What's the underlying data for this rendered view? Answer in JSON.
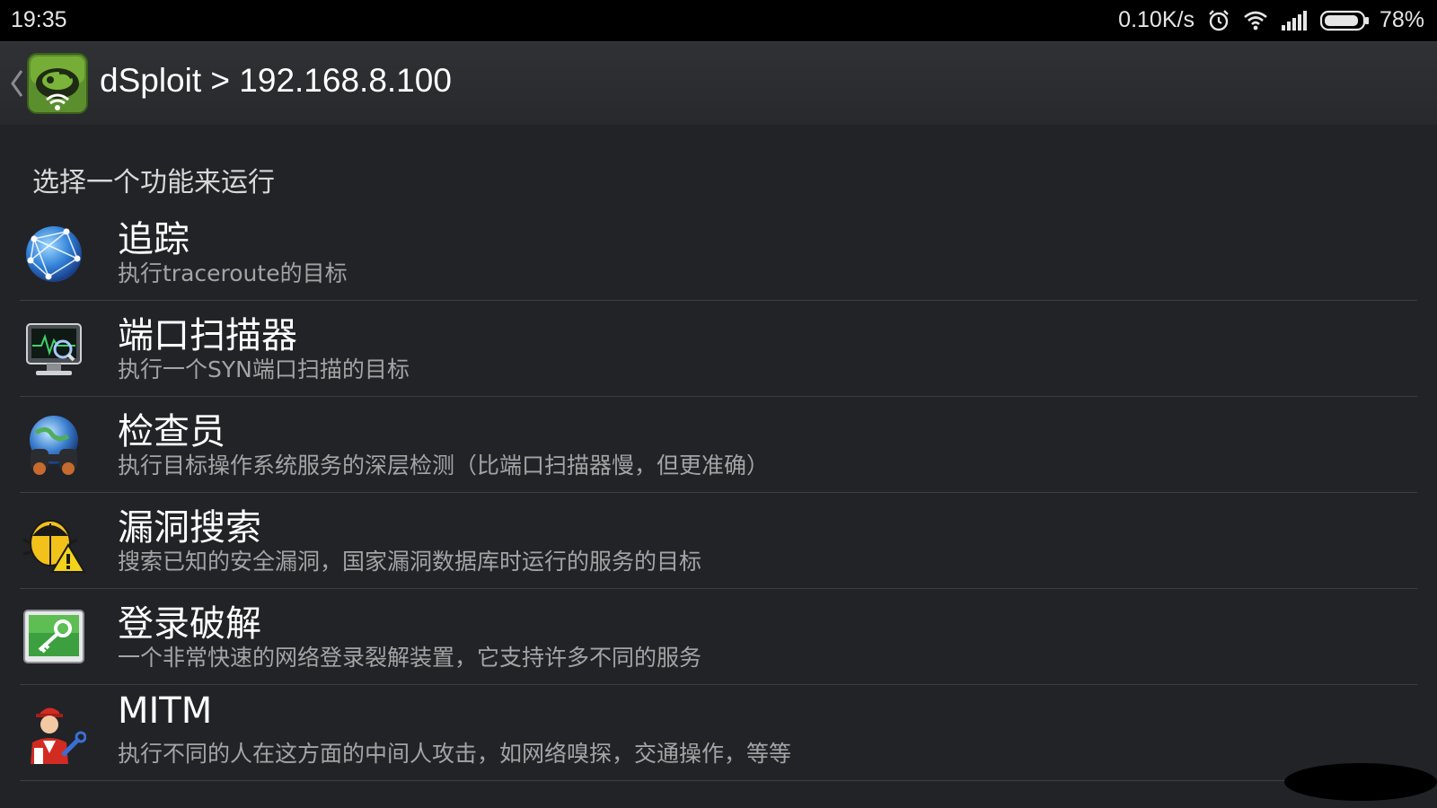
{
  "status_bar": {
    "time": "19:35",
    "net_speed": "0.10K/s",
    "battery": "78%",
    "icons": [
      "alarm-icon",
      "wifi-icon",
      "signal-icon",
      "battery-icon"
    ]
  },
  "action_bar": {
    "title": "dSploit > 192.168.8.100",
    "icons": [
      "back-chevron-icon",
      "dsploit-logo-icon"
    ]
  },
  "section_header": "选择一个功能来运行",
  "items": [
    {
      "title": "追踪",
      "desc": "执行traceroute的目标",
      "icon": "globe-network-icon"
    },
    {
      "title": "端口扫描器",
      "desc": "执行一个SYN端口扫描的目标",
      "icon": "monitor-scan-icon"
    },
    {
      "title": "检查员",
      "desc": "执行目标操作系统服务的深层检测（比端口扫描器慢，但更准确）",
      "icon": "globe-binoculars-icon"
    },
    {
      "title": "漏洞搜索",
      "desc": "搜索已知的安全漏洞，国家漏洞数据库时运行的服务的目标",
      "icon": "bug-warning-icon"
    },
    {
      "title": "登录破解",
      "desc": "一个非常快速的网络登录裂解装置，它支持许多不同的服务",
      "icon": "key-screen-icon"
    },
    {
      "title": "MITM",
      "desc": "执行不同的人在这方面的中间人攻击，如网络嗅探，交通操作，等等",
      "icon": "man-wrench-icon"
    }
  ],
  "colors": {
    "background": "#212327",
    "status_bar": "#000000",
    "action_bar": "#2c2e31",
    "title_text": "#ffffff",
    "desc_text": "#a4a4a4",
    "divider": "#3c3f44"
  }
}
